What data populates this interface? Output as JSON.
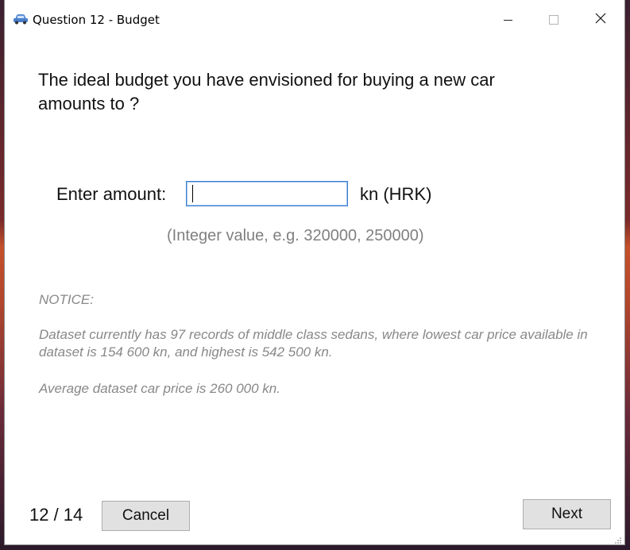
{
  "window": {
    "title": "Question 12 - Budget",
    "icon": "car-icon"
  },
  "question": {
    "text": "The ideal budget you have envisioned for buying a new car amounts to ?"
  },
  "amount": {
    "label": "Enter amount:",
    "value": "",
    "unit": "kn (HRK)",
    "hint": "(Integer value, e.g. 320000, 250000)"
  },
  "notice": {
    "title": "NOTICE:",
    "line1": "Dataset currently has 97 records of middle class sedans, where lowest car price available in dataset is 154 600 kn, and highest is 542 500 kn.",
    "line2": "Average dataset car price is 260 000 kn."
  },
  "footer": {
    "page_counter": "12 / 14",
    "cancel_label": "Cancel",
    "next_label": "Next"
  },
  "colors": {
    "input_border": "#3b7fd4",
    "button_bg": "#e1e1e1",
    "notice_text": "#888888"
  }
}
